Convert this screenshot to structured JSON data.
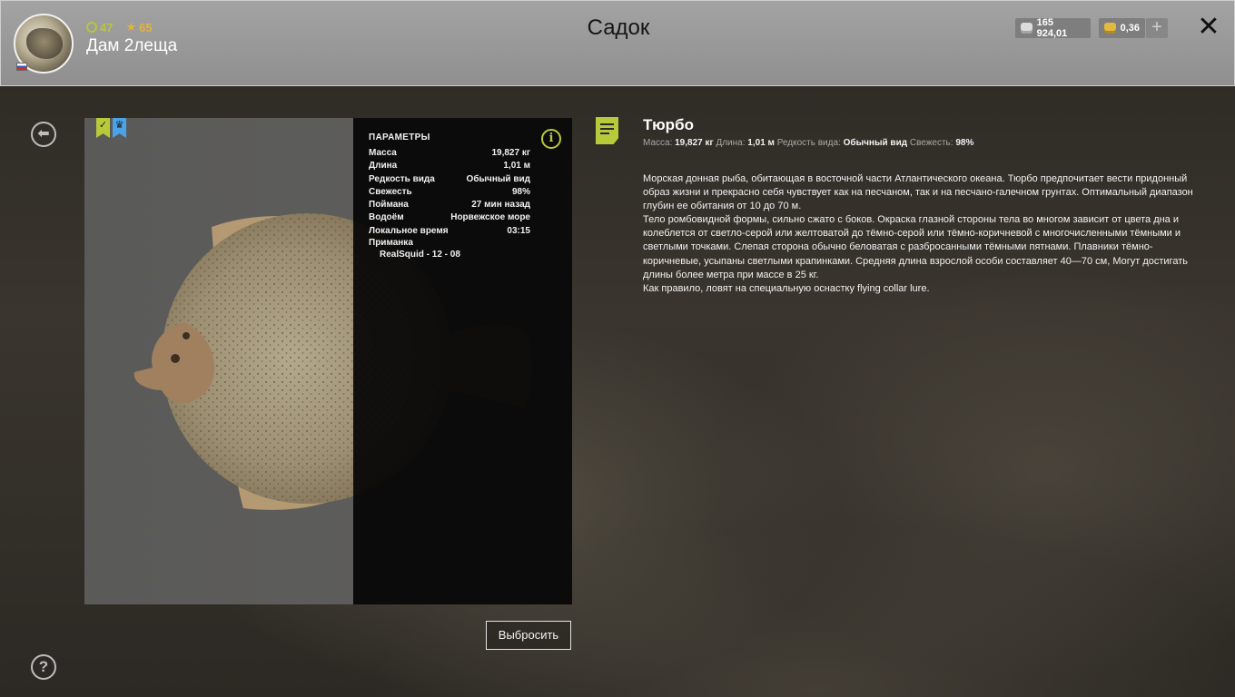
{
  "header": {
    "title": "Садок",
    "player": {
      "name": "Дам 2леща",
      "level": "47",
      "rank": "65"
    },
    "currency": {
      "silver": "165 924,01",
      "gold": "0,36",
      "add_label": "+"
    },
    "close_label": "✕"
  },
  "sidebar": {
    "back_label": "⬅",
    "help_label": "?"
  },
  "card": {
    "params_title": "ПАРАМЕТРЫ",
    "params": [
      {
        "label": "Масса",
        "value": "19,827 кг"
      },
      {
        "label": "Длина",
        "value": "1,01 м"
      },
      {
        "label": "Редкость вида",
        "value": "Обычный вид"
      },
      {
        "label": "Свежесть",
        "value": "98%"
      },
      {
        "label": "Поймана",
        "value": "27 мин назад"
      },
      {
        "label": "Водоём",
        "value": "Норвежское море"
      },
      {
        "label": "Локальное время",
        "value": "03:15"
      }
    ],
    "bait_label": "Приманка",
    "bait_value": "RealSquid - 12 - 08",
    "info_label": "i",
    "discard_label": "Выбросить"
  },
  "fish": {
    "name": "Тюрбо",
    "meta": {
      "mass_label": "Масса:",
      "mass_value": "19,827 кг",
      "length_label": "Длина:",
      "length_value": "1,01 м",
      "rarity_label": "Редкость вида:",
      "rarity_value": "Обычный вид",
      "fresh_label": "Свежесть:",
      "fresh_value": "98%"
    },
    "description": [
      "Морская донная рыба, обитающая в восточной части Атлантического океана. Тюрбо предпочитает вести придонный образ жизни и прекрасно себя чувствует как на песчаном, так и на песчано-галечном грунтах. Оптимальный диапазон глубин ее обитания от 10 до 70 м.",
      "Тело ромбовидной формы, сильно сжато с боков. Окраска глазной стороны тела во многом зависит от цвета дна и колеблется от светло-серой или желтоватой до тёмно-серой или тёмно-коричневой с многочисленными тёмными и светлыми точками. Слепая сторона обычно беловатая с разбросанными тёмными пятнами. Плавники тёмно-коричневые, усыпаны светлыми крапинками. Средняя длина взрослой особи составляет 40—70 см, Могут достигать длины более метра при массе в 25 кг.",
      "Как правило, ловят на специальную оснастку flying collar lure."
    ]
  },
  "colors": {
    "accent": "#b9c93c",
    "gold": "#e3b33b",
    "blue_badge": "#4aa3e6"
  },
  "icons": {
    "level": "circle-icon",
    "rank": "star-icon",
    "silver": "silver-coin-icon",
    "gold": "gold-coin-icon",
    "badge_1": "checkmark-ribbon-icon",
    "badge_2": "crown-ribbon-icon",
    "info": "info-icon",
    "doc": "document-icon"
  }
}
